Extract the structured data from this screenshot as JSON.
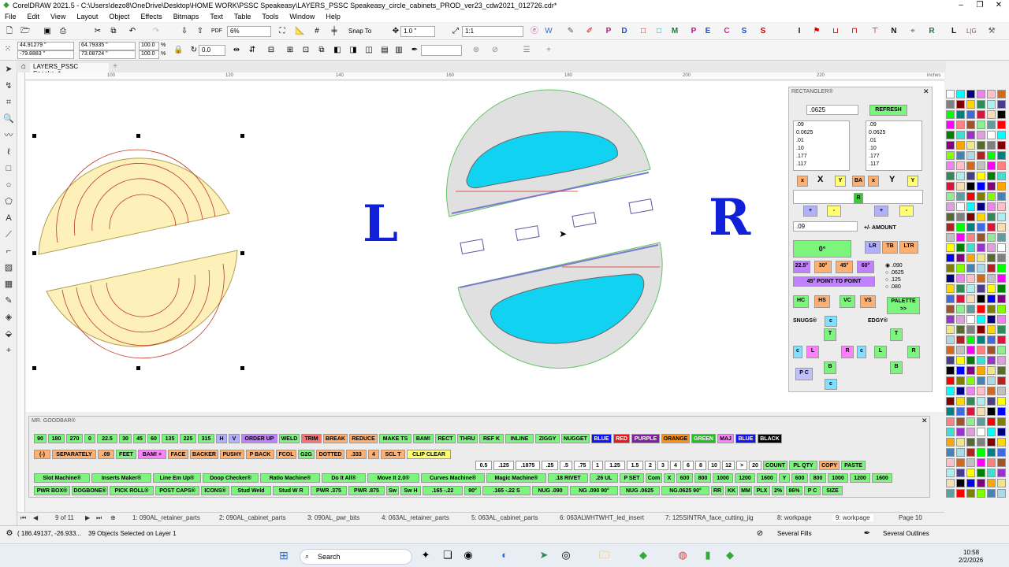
{
  "window": {
    "title": "CorelDRAW 2021.5 - C:\\Users\\dezo8\\OneDrive\\Desktop\\HOME WORK\\PSSC Speakeasy\\LAYERS_PSSC Speakeasy_circle_cabinets_PROD_ver23_cdw2021_012726.cdr*"
  },
  "menu": [
    "File",
    "Edit",
    "View",
    "Layout",
    "Object",
    "Effects",
    "Bitmaps",
    "Text",
    "Table",
    "Tools",
    "Window",
    "Help"
  ],
  "toolbar": {
    "zoom": "6%",
    "snap": "Snap To",
    "nudge": "1.0 \"",
    "scale": "1:1"
  },
  "property": {
    "x": "44.91279 \"",
    "y": "-79.8883 \"",
    "w": "64.79335 \"",
    "h": "73.08724 \"",
    "sx": "100.0",
    "sy": "100.0",
    "pct": "%",
    "angle": "0.0"
  },
  "doc_tab": "LAYERS_PSSC Speake..*",
  "ruler": [
    "100",
    "120",
    "140",
    "160",
    "180",
    "200",
    "220",
    "inches"
  ],
  "canvas": {
    "letter_left": "L",
    "letter_right": "R"
  },
  "rectangler": {
    "title": "RECTANGLER®",
    "size_value": ".0625",
    "refresh": "REFRESH",
    "list_x": [
      ".09",
      "0.0625",
      ".01",
      ".10",
      ".177",
      ".117"
    ],
    "list_y": [
      ".09",
      "0.0625",
      ".01",
      ".10",
      ".177",
      ".117"
    ],
    "x_label": "X",
    "y_label": "Y",
    "x_close": "x",
    "y_close": "x",
    "y_a": "Y",
    "ba": "BA",
    "plus": "+",
    "minus": "-",
    "amount_value": ".09",
    "amount_label": "+/- AMOUNT",
    "zero_deg": "0°",
    "lr": "LR",
    "tb": "TB",
    "ltr": "LTR",
    "deg22": "22.5°",
    "deg30": "30°",
    "deg45": "45°",
    "deg60": "60°",
    "pt2pt": "45° POINT TO POINT",
    "radios": [
      ".090",
      ".0625",
      ".125",
      ".080"
    ],
    "hc": "HC",
    "hs": "HS",
    "vc": "VC",
    "vs": "VS",
    "palette": "PALETTE >>",
    "snugs": "SNUGS®",
    "edgy": "EDGY®",
    "c": "c",
    "t": "T",
    "l": "L",
    "r": "R",
    "b": "B",
    "pc": "P C",
    "rr": "R"
  },
  "goodbar": {
    "title": "MR. GOODBAR®",
    "row1": [
      "90",
      "180",
      "270",
      "0",
      "22.5",
      "30",
      "45",
      "60",
      "135",
      "225",
      "315",
      "H",
      "V",
      "ORDER UP",
      "WELD",
      "TRIM",
      "BREAK",
      "REDUCE",
      "MAKE TS",
      "BAM!",
      "RECT",
      "THRU",
      "REF K",
      "INLINE",
      "ZIGGY",
      "NUGGET",
      "BLUE",
      "RED",
      "PURPLE",
      "ORANGE",
      "GREEN",
      "MAJ",
      "BLUE",
      "BLACK"
    ],
    "row2": [
      "(-)",
      "SEPARATELY",
      ".09",
      "FEET",
      "BAM! +",
      "FACE",
      "BACKER",
      "PUSHY",
      "P BACK",
      "FCOL",
      "G2G",
      "DOTTED",
      ".333",
      "4",
      "SCL T",
      "CLIP CLEAR"
    ],
    "row3": [
      "0.5",
      ".125",
      ".1875",
      ".25",
      ".5",
      ".75",
      "1",
      "1.25",
      "1.5",
      "2",
      "3",
      "4",
      "6",
      "8",
      "10",
      "12",
      ">",
      "20",
      "COUNT",
      "PL QTY",
      "COPY",
      "PASTE"
    ],
    "row4": [
      "Slot Machine®",
      "Inserts Maker®",
      "Line Em Up®",
      "Doop Checker®",
      "Ratio Machine®",
      "Do It All®",
      "Move It 2.0®",
      "Curves Machine®",
      "Magic Machine®",
      ".18 RIVET",
      ".26 UL",
      "P SET",
      "Com",
      "X",
      "600",
      "800",
      "1000",
      "1200",
      "1600",
      "Y",
      "600",
      "800",
      "1000",
      "1200",
      "1600"
    ],
    "row5": [
      "PWR BOX®",
      "DOGBONE®",
      "PICK ROLL®",
      "POST CAPS®",
      "ICONS®",
      "Stud Weld",
      "Stud W R",
      "PWR .375",
      "PWR .875",
      "Sw",
      "Sw H",
      ".165 -.22",
      "90°",
      ".165 -.22 S",
      "NUG .090",
      "NG .090 90°",
      "NUG .0625",
      "NG.0625 90°",
      "RR",
      "KK",
      "MM",
      "PLX",
      "2%",
      "86%",
      "P C",
      "SIZE"
    ]
  },
  "pages": [
    "1: 090AL_retainer_parts",
    "2: 090AL_cabinet_parts",
    "3: 090AL_pwr_bits",
    "4: 063AL_retainer_parts",
    "5: 063AL_cabinet_parts",
    "6: 063ALWHTWHT_led_insert",
    "7: 125SINTRA_face_cutting_jig",
    "8: workpage",
    "9: workpage"
  ],
  "page_nav": "9 of 11",
  "page_label": "Page 10",
  "status": {
    "coords": "( 186.49137, -26.933...",
    "selection": "39 Objects Selected on Layer 1",
    "fill": "Several Fills",
    "outline": "Several Outlines"
  },
  "taskbar": {
    "search": "Search",
    "time": "10:58",
    "date": "2/2/2026"
  },
  "palette_colors": [
    "#ffffff",
    "#000000",
    "#c0c0c0",
    "#808080",
    "#ff0000",
    "#ffff00",
    "#00ff00",
    "#00ffff",
    "#0000ff",
    "#ff00ff",
    "#800000",
    "#808000",
    "#008000",
    "#008080",
    "#000080",
    "#800080",
    "#ff8080",
    "#ffd700",
    "#7fff00",
    "#40e0d0",
    "#4169e1",
    "#ee82ee",
    "#ffa500",
    "#a0522d",
    "#2e8b57",
    "#4682b4",
    "#9932cc",
    "#dc143c",
    "#ffc0cb",
    "#f0e68c",
    "#90ee90",
    "#afeeee",
    "#add8e6",
    "#dda0dd",
    "#f5deb3",
    "#d2691e",
    "#556b2f",
    "#5f9ea0",
    "#483d8b",
    "#b22222"
  ]
}
